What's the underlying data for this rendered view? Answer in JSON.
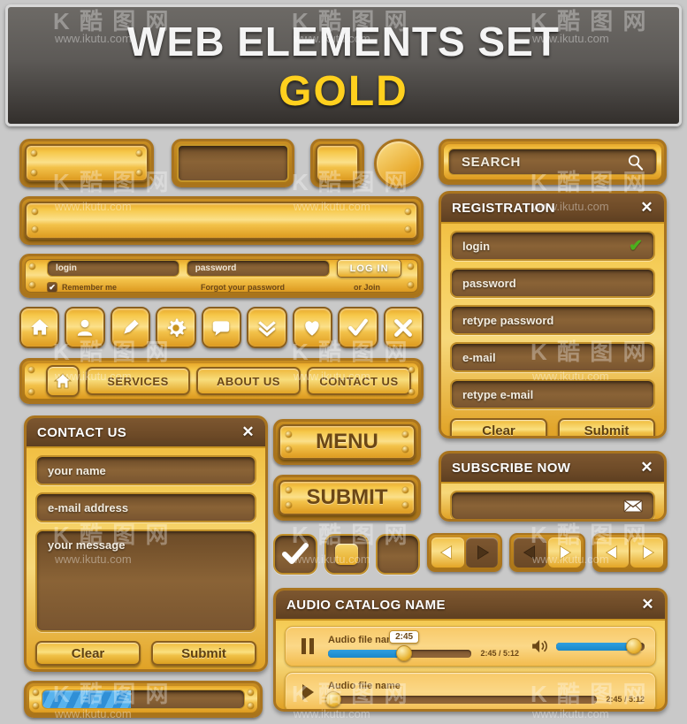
{
  "banner": {
    "title": "WEB ELEMENTS SET",
    "subtitle": "GOLD"
  },
  "colors": {
    "gold_light": "#fbe08a",
    "gold_mid": "#f3c24a",
    "gold_dark": "#dd9a1f",
    "brown": "#6f4d28",
    "header_brown": "#6d4a27",
    "accent_blue": "#1e9fe0",
    "check_green": "#4caf1d",
    "banner_bg": "#5d5a57",
    "page_bg": "#c9c9c9"
  },
  "search": {
    "placeholder": "SEARCH",
    "icon": "magnifier-icon"
  },
  "registration": {
    "title": "REGISTRATION",
    "close": "✕",
    "fields": [
      {
        "label": "login",
        "valid": true
      },
      {
        "label": "password",
        "valid": false
      },
      {
        "label": "retype password",
        "valid": false
      },
      {
        "label": "e-mail",
        "valid": false
      },
      {
        "label": "retype e-mail",
        "valid": false
      }
    ],
    "clear_label": "Clear",
    "submit_label": "Submit"
  },
  "subscribe": {
    "title": "SUBSCRIBE NOW",
    "close": "✕",
    "input_value": "",
    "icon": "envelope-icon"
  },
  "login_bar": {
    "login_placeholder": "login",
    "password_placeholder": "password",
    "button_label": "LOG IN",
    "remember_label": "Remember me",
    "remember_checked": true,
    "forgot_label": "Forgot your password",
    "join_label": "or Join"
  },
  "icon_buttons": [
    {
      "name": "home-icon",
      "glyph": "⌂"
    },
    {
      "name": "user-icon",
      "glyph": "●"
    },
    {
      "name": "pencil-icon",
      "glyph": "✎"
    },
    {
      "name": "gear-icon",
      "glyph": "⚙"
    },
    {
      "name": "speech-bubble-icon",
      "glyph": "▭"
    },
    {
      "name": "double-chevron-down-icon",
      "glyph": "»"
    },
    {
      "name": "heart-icon",
      "glyph": "♥"
    },
    {
      "name": "check-icon",
      "glyph": "✔"
    },
    {
      "name": "close-icon",
      "glyph": "✕"
    }
  ],
  "navbar": {
    "home_icon": "home-icon",
    "items": [
      "SERVICES",
      "ABOUT US",
      "CONTACT US"
    ]
  },
  "contact_form": {
    "title": "CONTACT US",
    "close": "✕",
    "name_placeholder": "your name",
    "email_placeholder": "e-mail address",
    "message_placeholder": "your message",
    "clear_label": "Clear",
    "submit_label": "Submit"
  },
  "big_buttons": [
    "MENU",
    "SUBMIT"
  ],
  "checkboxes": [
    {
      "name": "checkbox-checked",
      "state": "checked"
    },
    {
      "name": "checkbox-partial",
      "state": "partial"
    },
    {
      "name": "checkbox-empty",
      "state": "empty"
    }
  ],
  "arrow_pairs": [
    {
      "prev_active": true,
      "next_active": false
    },
    {
      "prev_active": false,
      "next_active": true
    },
    {
      "prev_active": true,
      "next_active": true
    }
  ],
  "audio_player": {
    "title": "AUDIO CATALOG NAME",
    "close": "✕",
    "volume_icon": "speaker-icon",
    "volume_percent": 88,
    "tracks": [
      {
        "transport_icon": "pause-icon",
        "name": "Audio file name",
        "tooltip": "2:45",
        "progress_percent": 53,
        "time": "2:45 / 5:12"
      },
      {
        "transport_icon": "play-icon",
        "name": "Audio file name",
        "tooltip": "",
        "progress_percent": 2,
        "time": "2:45 / 5:12"
      }
    ]
  },
  "progress_bar": {
    "percent": 44
  },
  "watermarks": {
    "url": "www.ikutu.com",
    "logo": "K 酷 图 网"
  }
}
